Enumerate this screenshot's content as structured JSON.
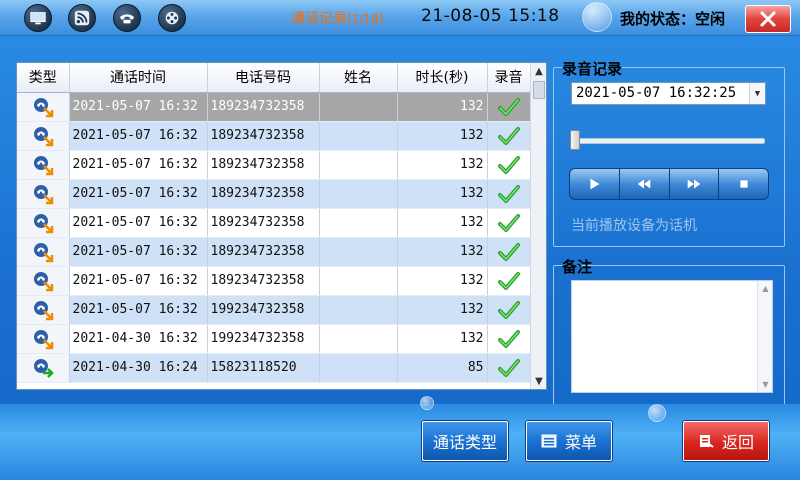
{
  "titlebar": {
    "title": "通话记录",
    "page_indicator": "[1/18]",
    "datetime": "21-08-05  15:18",
    "status": "我的状态：空闲",
    "icons": [
      "monitor-icon",
      "rss-icon",
      "phone-icon",
      "film-reel-icon",
      "close-icon"
    ]
  },
  "table": {
    "columns": [
      "类型",
      "通话时间",
      "电话号码",
      "姓名",
      "时长(秒)",
      "录音"
    ],
    "rows": [
      {
        "type": "incoming",
        "time": "2021-05-07 16:32",
        "phone": "189234732358",
        "name": "",
        "duration": "132",
        "recorded": true
      },
      {
        "type": "incoming",
        "time": "2021-05-07 16:32",
        "phone": "189234732358",
        "name": "",
        "duration": "132",
        "recorded": true
      },
      {
        "type": "incoming",
        "time": "2021-05-07 16:32",
        "phone": "189234732358",
        "name": "",
        "duration": "132",
        "recorded": true
      },
      {
        "type": "incoming",
        "time": "2021-05-07 16:32",
        "phone": "189234732358",
        "name": "",
        "duration": "132",
        "recorded": true
      },
      {
        "type": "incoming",
        "time": "2021-05-07 16:32",
        "phone": "189234732358",
        "name": "",
        "duration": "132",
        "recorded": true
      },
      {
        "type": "incoming",
        "time": "2021-05-07 16:32",
        "phone": "189234732358",
        "name": "",
        "duration": "132",
        "recorded": true
      },
      {
        "type": "incoming",
        "time": "2021-05-07 16:32",
        "phone": "189234732358",
        "name": "",
        "duration": "132",
        "recorded": true
      },
      {
        "type": "incoming",
        "time": "2021-05-07 16:32",
        "phone": "199234732358",
        "name": "",
        "duration": "132",
        "recorded": true
      },
      {
        "type": "incoming",
        "time": "2021-04-30 16:32",
        "phone": "199234732358",
        "name": "",
        "duration": "132",
        "recorded": true
      },
      {
        "type": "outgoing",
        "time": "2021-04-30 16:24",
        "phone": "15823118520",
        "name": "",
        "duration": "85",
        "recorded": true
      }
    ],
    "selected_index": 0
  },
  "recording": {
    "title": "录音记录",
    "selected_datetime": "2021-05-07 16:32:25",
    "progress": 0,
    "controls": [
      "play-icon",
      "rewind-icon",
      "fast-forward-icon",
      "stop-icon"
    ],
    "device_text": "当前播放设备为话机"
  },
  "notes": {
    "title": "备注",
    "value": ""
  },
  "buttons": {
    "call_type": "通话类型",
    "menu": "菜单",
    "back": "返回"
  },
  "colors": {
    "title_accent": "#ff6a00",
    "row_alt": "#cfe1f7",
    "row_selected": "#a6a6a6",
    "back_button": "#d9261f",
    "primary_button": "#1a6fcf"
  }
}
